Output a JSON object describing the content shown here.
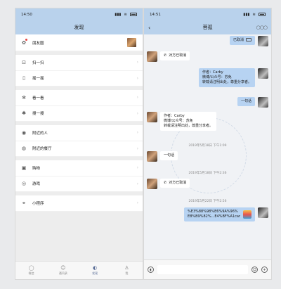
{
  "left": {
    "status": {
      "time": "14:50",
      "carrier": "四G"
    },
    "title": "发现",
    "items": [
      {
        "label": "朋友圈",
        "icon": "moments-icon"
      },
      {
        "label": "扫一扫",
        "icon": "scan-icon"
      },
      {
        "label": "摇一摇",
        "icon": "shake-icon"
      },
      {
        "label": "看一看",
        "icon": "top-stories-icon"
      },
      {
        "label": "搜一搜",
        "icon": "search-icon"
      },
      {
        "label": "附近的人",
        "icon": "people-nearby-icon"
      },
      {
        "label": "附近的餐厅",
        "icon": "restaurant-icon"
      },
      {
        "label": "购物",
        "icon": "shopping-icon"
      },
      {
        "label": "游戏",
        "icon": "games-icon"
      },
      {
        "label": "小程序",
        "icon": "mini-program-icon"
      }
    ],
    "tabs": [
      {
        "label": "微信"
      },
      {
        "label": "通讯录"
      },
      {
        "label": "发现"
      },
      {
        "label": "我"
      }
    ]
  },
  "right": {
    "status": {
      "time": "14:51",
      "carrier": "四G"
    },
    "title": "菩孤",
    "messages": {
      "m1": "已取消",
      "m2": "对方已取消",
      "m3a": "作者：Carby",
      "m3b": "微博/公众号：苏免",
      "m3c": "转载请注明出处，尊重分享者。",
      "m4": "一句话",
      "m5a": "作者：Carby",
      "m5b": "微博/公众号：苏免",
      "m5c": "转载请注明出处，尊重分享者。",
      "ts1": "2019年5月18日 下午1:09",
      "m6": "一句话",
      "ts2": "2019年5月18日 下午2:36",
      "m7": "对方已取消",
      "ts3": "2019年5月22日 下午2:56",
      "m8a": "%E3%88%98%E6%9A%96%",
      "m8b": "E8%B9%82%...E4%BF%A1car"
    }
  }
}
